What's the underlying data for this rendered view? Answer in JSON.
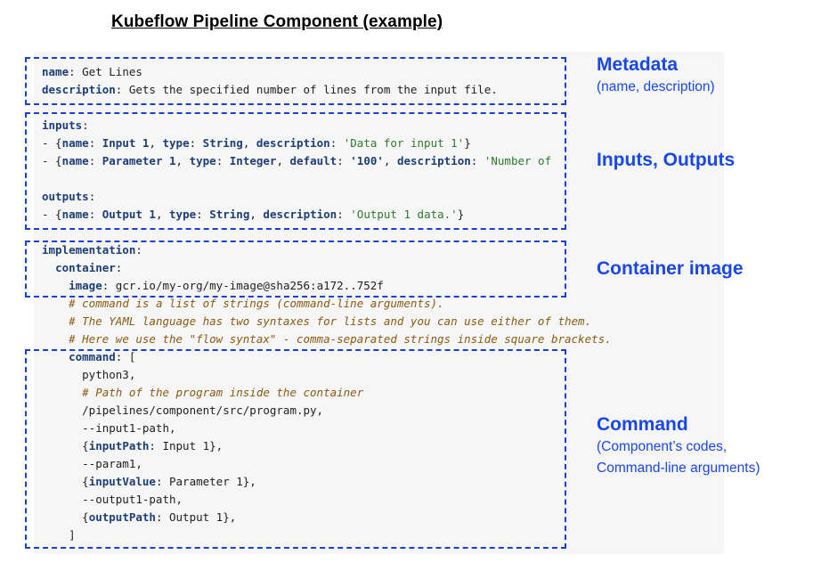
{
  "title": "Kubeflow Pipeline Component (example)",
  "code_lines": [
    [
      [
        "k",
        "name"
      ],
      [
        "p",
        ": Get Lines"
      ]
    ],
    [
      [
        "k",
        "description"
      ],
      [
        "p",
        ": Gets the specified number of lines from the input file."
      ]
    ],
    [],
    [
      [
        "k",
        "inputs"
      ],
      [
        "p",
        ":"
      ]
    ],
    [
      [
        "p",
        "- {"
      ],
      [
        "k",
        "name"
      ],
      [
        "p",
        ": "
      ],
      [
        "k",
        "Input 1"
      ],
      [
        "p",
        ", "
      ],
      [
        "k",
        "type"
      ],
      [
        "p",
        ": "
      ],
      [
        "k",
        "String"
      ],
      [
        "p",
        ", "
      ],
      [
        "k",
        "description"
      ],
      [
        "p",
        ": "
      ],
      [
        "s",
        "'Data for input 1'"
      ],
      [
        "p",
        "}"
      ]
    ],
    [
      [
        "p",
        "- {"
      ],
      [
        "k",
        "name"
      ],
      [
        "p",
        ": "
      ],
      [
        "k",
        "Parameter 1"
      ],
      [
        "p",
        ", "
      ],
      [
        "k",
        "type"
      ],
      [
        "p",
        ": "
      ],
      [
        "k",
        "Integer"
      ],
      [
        "p",
        ", "
      ],
      [
        "k",
        "default"
      ],
      [
        "p",
        ": "
      ],
      [
        "k",
        "'100'"
      ],
      [
        "p",
        ", "
      ],
      [
        "k",
        "description"
      ],
      [
        "p",
        ": "
      ],
      [
        "s",
        "'Number of"
      ]
    ],
    [],
    [
      [
        "k",
        "outputs"
      ],
      [
        "p",
        ":"
      ]
    ],
    [
      [
        "p",
        "- {"
      ],
      [
        "k",
        "name"
      ],
      [
        "p",
        ": "
      ],
      [
        "k",
        "Output 1"
      ],
      [
        "p",
        ", "
      ],
      [
        "k",
        "type"
      ],
      [
        "p",
        ": "
      ],
      [
        "k",
        "String"
      ],
      [
        "p",
        ", "
      ],
      [
        "k",
        "description"
      ],
      [
        "p",
        ": "
      ],
      [
        "s",
        "'Output 1 data.'"
      ],
      [
        "p",
        "}"
      ]
    ],
    [],
    [
      [
        "k",
        "implementation"
      ],
      [
        "p",
        ":"
      ]
    ],
    [
      [
        "p",
        "  "
      ],
      [
        "k",
        "container"
      ],
      [
        "p",
        ":"
      ]
    ],
    [
      [
        "p",
        "    "
      ],
      [
        "k",
        "image"
      ],
      [
        "p",
        ": gcr.io/my-org/my-image@sha256:a172..752f"
      ]
    ],
    [
      [
        "p",
        "    "
      ],
      [
        "c",
        "# command is a list of strings (command-line arguments)."
      ]
    ],
    [
      [
        "p",
        "    "
      ],
      [
        "c",
        "# The YAML language has two syntaxes for lists and you can use either of them."
      ]
    ],
    [
      [
        "p",
        "    "
      ],
      [
        "c",
        "# Here we use the \"flow syntax\" - comma-separated strings inside square brackets."
      ]
    ],
    [
      [
        "p",
        "    "
      ],
      [
        "k",
        "command"
      ],
      [
        "p",
        ": ["
      ]
    ],
    [
      [
        "p",
        "      python3,"
      ]
    ],
    [
      [
        "p",
        "      "
      ],
      [
        "c",
        "# Path of the program inside the container"
      ]
    ],
    [
      [
        "p",
        "      /pipelines/component/src/program.py,"
      ]
    ],
    [
      [
        "p",
        "      --input1-path,"
      ]
    ],
    [
      [
        "p",
        "      {"
      ],
      [
        "k",
        "inputPath"
      ],
      [
        "p",
        ": Input 1},"
      ]
    ],
    [
      [
        "p",
        "      --param1,"
      ]
    ],
    [
      [
        "p",
        "      {"
      ],
      [
        "k",
        "inputValue"
      ],
      [
        "p",
        ": Parameter 1},"
      ]
    ],
    [
      [
        "p",
        "      --output1-path,"
      ]
    ],
    [
      [
        "p",
        "      {"
      ],
      [
        "k",
        "outputPath"
      ],
      [
        "p",
        ": Output 1},"
      ]
    ],
    [
      [
        "p",
        "    ]"
      ]
    ]
  ],
  "annotations": {
    "metadata": {
      "heading": "Metadata",
      "sub1": "(name, description)"
    },
    "io": {
      "heading": "Inputs, Outputs"
    },
    "container": {
      "heading": "Container image"
    },
    "command": {
      "heading": "Command",
      "sub1": "(Component’s codes,",
      "sub2": "Command-line arguments)"
    }
  },
  "colors": {
    "accent": "#1a47e8",
    "box_border": "#1a40d6",
    "code_bg": "#f6f6f6"
  }
}
